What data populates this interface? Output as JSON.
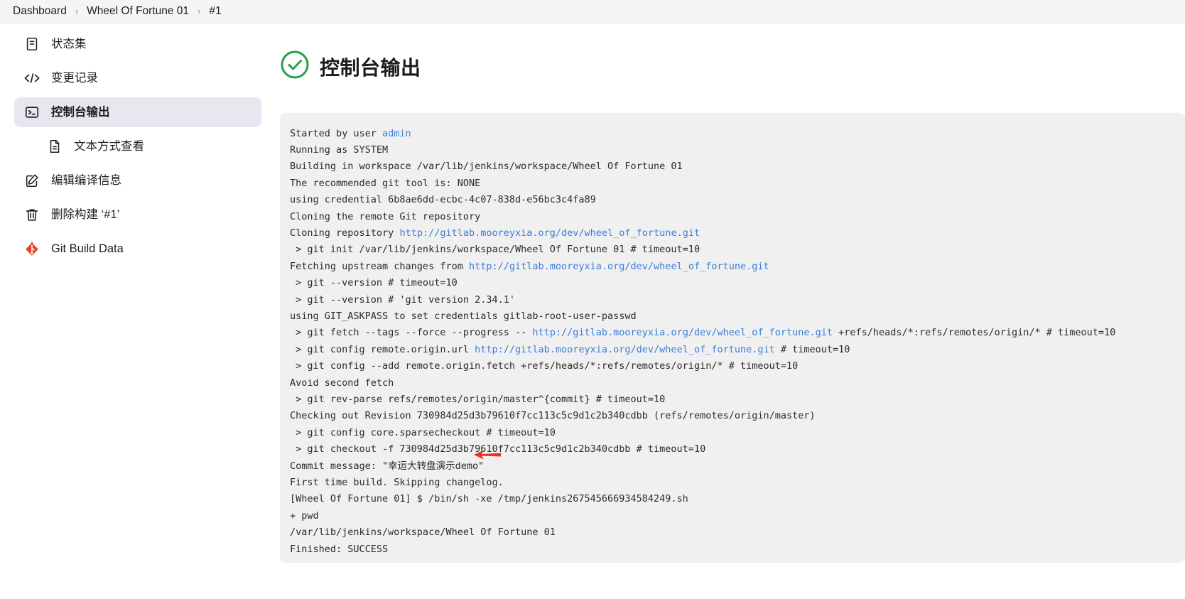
{
  "breadcrumb": {
    "items": [
      {
        "label": "Dashboard"
      },
      {
        "label": "Wheel Of Fortune 01"
      },
      {
        "label": "#1"
      }
    ],
    "separator": "›"
  },
  "sidebar": {
    "items": [
      {
        "label": "状态集",
        "icon": "document-icon",
        "selected": false,
        "sub": false
      },
      {
        "label": "变更记录",
        "icon": "code-icon",
        "selected": false,
        "sub": false
      },
      {
        "label": "控制台输出",
        "icon": "terminal-icon",
        "selected": true,
        "sub": false
      },
      {
        "label": "文本方式查看",
        "icon": "file-text-icon",
        "selected": false,
        "sub": true
      },
      {
        "label": "编辑编译信息",
        "icon": "edit-icon",
        "selected": false,
        "sub": false
      },
      {
        "label": "删除构建 ‘#1’",
        "icon": "trash-icon",
        "selected": false,
        "sub": false
      },
      {
        "label": "Git Build Data",
        "icon": "git-icon",
        "selected": false,
        "sub": false
      }
    ]
  },
  "main": {
    "status_icon": "check-circle-icon",
    "status_color": "#22a14b",
    "title": "控制台输出",
    "annotation": {
      "icon": "red-arrow-left-icon",
      "color": "#e8312a"
    }
  },
  "console": {
    "lines": [
      [
        {
          "t": "Started by user "
        },
        {
          "t": "admin",
          "k": "link"
        }
      ],
      [
        {
          "t": "Running as SYSTEM"
        }
      ],
      [
        {
          "t": "Building in workspace /var/lib/jenkins/workspace/Wheel Of Fortune 01"
        }
      ],
      [
        {
          "t": "The recommended git tool is: NONE"
        }
      ],
      [
        {
          "t": "using credential 6b8ae6dd-ecbc-4c07-838d-e56bc3c4fa89"
        }
      ],
      [
        {
          "t": "Cloning the remote Git repository"
        }
      ],
      [
        {
          "t": "Cloning repository "
        },
        {
          "t": "http://gitlab.mooreyxia.org/dev/wheel_of_fortune.git",
          "k": "link"
        }
      ],
      [
        {
          "t": " > git init /var/lib/jenkins/workspace/Wheel Of Fortune 01 # timeout=10"
        }
      ],
      [
        {
          "t": "Fetching upstream changes from "
        },
        {
          "t": "http://gitlab.mooreyxia.org/dev/wheel_of_fortune.git",
          "k": "link"
        }
      ],
      [
        {
          "t": " > git --version # timeout=10"
        }
      ],
      [
        {
          "t": " > git --version # 'git version 2.34.1'"
        }
      ],
      [
        {
          "t": "using GIT_ASKPASS to set credentials gitlab-root-user-passwd"
        }
      ],
      [
        {
          "t": " > git fetch --tags --force --progress -- "
        },
        {
          "t": "http://gitlab.mooreyxia.org/dev/wheel_of_fortune.git",
          "k": "link"
        },
        {
          "t": " +refs/heads/*:refs/remotes/origin/* # timeout=10"
        }
      ],
      [
        {
          "t": " > git config remote.origin.url "
        },
        {
          "t": "http://gitlab.mooreyxia.org/dev/wheel_of_fortune.git",
          "k": "link"
        },
        {
          "t": " # timeout=10"
        }
      ],
      [
        {
          "t": " > git config --add remote.origin.fetch +refs/heads/*:refs/remotes/origin/* # timeout=10"
        }
      ],
      [
        {
          "t": "Avoid second fetch"
        }
      ],
      [
        {
          "t": " > git rev-parse refs/remotes/origin/master^{commit} # timeout=10"
        }
      ],
      [
        {
          "t": "Checking out Revision 730984d25d3b79610f7cc113c5c9d1c2b340cdbb (refs/remotes/origin/master)"
        }
      ],
      [
        {
          "t": " > git config core.sparsecheckout # timeout=10"
        }
      ],
      [
        {
          "t": " > git checkout -f 730984d25d3b79610f7cc113c5c9d1c2b340cdbb # timeout=10"
        }
      ],
      [
        {
          "t": "Commit message: \"幸运大转盘演示demo\""
        }
      ],
      [
        {
          "t": "First time build. Skipping changelog."
        }
      ],
      [
        {
          "t": "[Wheel Of Fortune 01] $ /bin/sh -xe /tmp/jenkins267545666934584249.sh"
        }
      ],
      [
        {
          "t": "+ pwd"
        }
      ],
      [
        {
          "t": "/var/lib/jenkins/workspace/Wheel Of Fortune 01"
        }
      ],
      [
        {
          "t": "Finished: SUCCESS"
        }
      ]
    ]
  }
}
